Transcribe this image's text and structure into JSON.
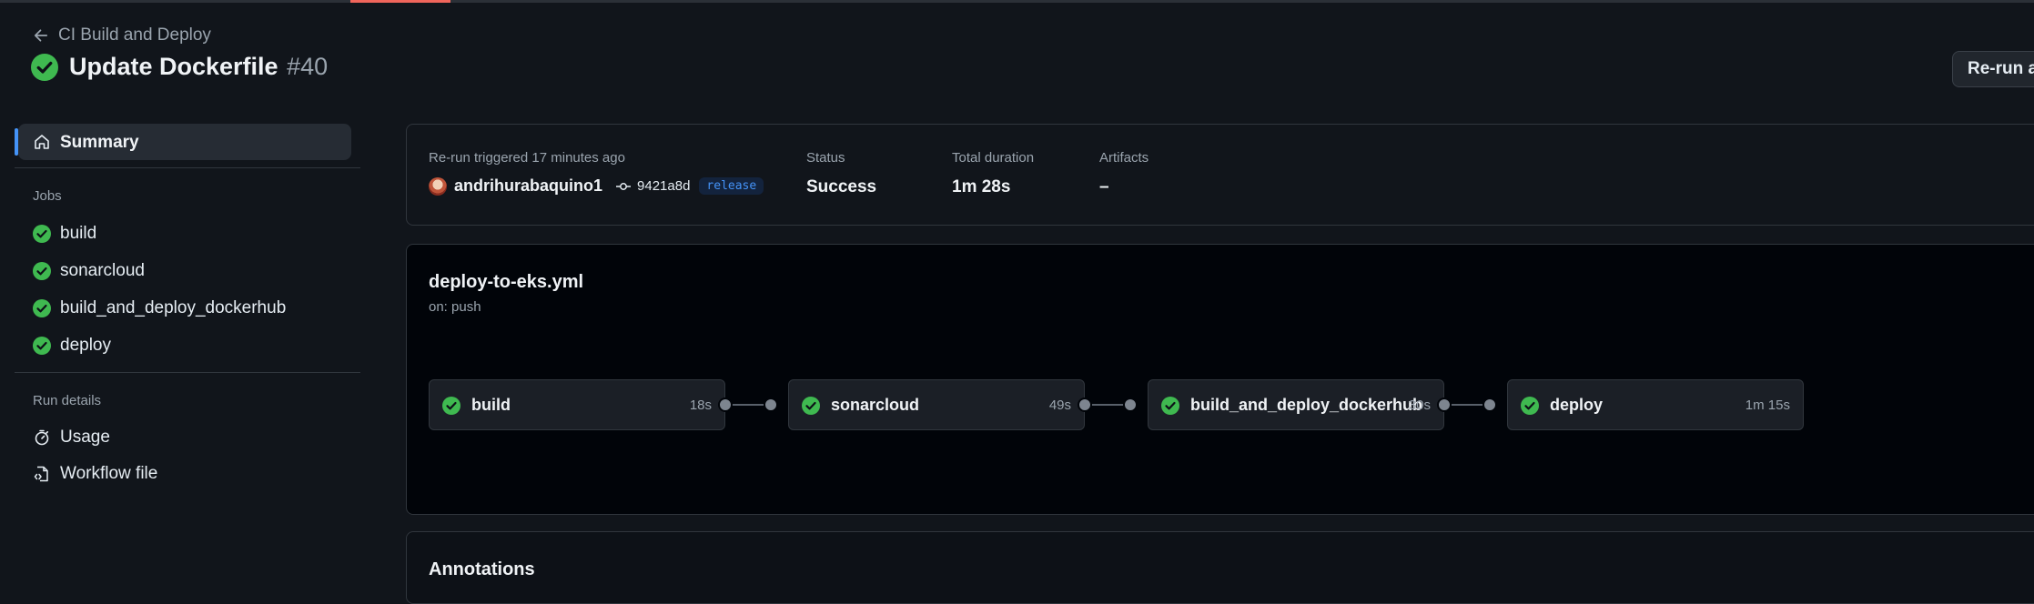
{
  "header": {
    "back_label": "CI Build and Deploy",
    "title": "Update Dockerfile",
    "run_number": "#40",
    "rerun_button": "Re-run all jobs"
  },
  "sidebar": {
    "summary_label": "Summary",
    "jobs_heading": "Jobs",
    "jobs": [
      {
        "label": "build",
        "status": "success"
      },
      {
        "label": "sonarcloud",
        "status": "success"
      },
      {
        "label": "build_and_deploy_dockerhub",
        "status": "success"
      },
      {
        "label": "deploy",
        "status": "success"
      }
    ],
    "run_details_heading": "Run details",
    "run_details": [
      {
        "label": "Usage",
        "icon": "stopwatch-icon"
      },
      {
        "label": "Workflow file",
        "icon": "file-code-icon"
      }
    ]
  },
  "summary": {
    "trigger_text": "Re-run triggered 17 minutes ago",
    "actor": "andrihurabaquino1",
    "commit": "9421a8d",
    "branch": "release",
    "status_label": "Status",
    "status_value": "Success",
    "duration_label": "Total duration",
    "duration_value": "1m 28s",
    "artifacts_label": "Artifacts",
    "artifacts_value": "–"
  },
  "workflow": {
    "file": "deploy-to-eks.yml",
    "trigger": "on: push",
    "jobs": [
      {
        "name": "build",
        "duration": "18s"
      },
      {
        "name": "sonarcloud",
        "duration": "49s"
      },
      {
        "name": "build_and_deploy_dockerhub",
        "duration": "30s"
      },
      {
        "name": "deploy",
        "duration": "1m 15s"
      }
    ]
  },
  "annotations": {
    "title": "Annotations"
  },
  "colors": {
    "success": "#3fb950",
    "accent_blue": "#4493f8",
    "background": "#11151b"
  }
}
